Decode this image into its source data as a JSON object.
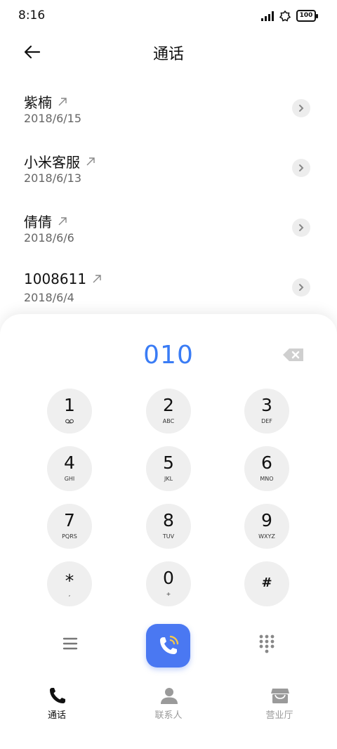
{
  "status_bar": {
    "time": "8:16",
    "battery": "100"
  },
  "header": {
    "title": "通话"
  },
  "calls": [
    {
      "name": "紫楠",
      "date": "2018/6/15"
    },
    {
      "name": "小米客服",
      "date": "2018/6/13"
    },
    {
      "name": "倩倩",
      "date": "2018/6/6"
    },
    {
      "name": "1008611",
      "date": "2018/6/4"
    }
  ],
  "dialer": {
    "number": "010",
    "keys": [
      {
        "digit": "1",
        "letters": ""
      },
      {
        "digit": "2",
        "letters": "ABC"
      },
      {
        "digit": "3",
        "letters": "DEF"
      },
      {
        "digit": "4",
        "letters": "GHI"
      },
      {
        "digit": "5",
        "letters": "JKL"
      },
      {
        "digit": "6",
        "letters": "MNO"
      },
      {
        "digit": "7",
        "letters": "PQRS"
      },
      {
        "digit": "8",
        "letters": "TUV"
      },
      {
        "digit": "9",
        "letters": "WXYZ"
      },
      {
        "digit": "*",
        "letters": ","
      },
      {
        "digit": "0",
        "letters": "+"
      },
      {
        "digit": "#",
        "letters": ""
      }
    ]
  },
  "nav": {
    "calls_label": "通话",
    "contacts_label": "联系人",
    "store_label": "营业厅"
  },
  "colors": {
    "accent": "#3a7cf5",
    "call_button": "#4a78f2",
    "key_bg": "#efefef",
    "inactive": "#9a9a9a"
  },
  "icons": [
    "signal-icon",
    "settings-icon",
    "battery-icon",
    "back-arrow-icon",
    "outgoing-call-icon",
    "chevron-right-icon",
    "backspace-icon",
    "voicemail-icon",
    "menu-icon",
    "phone-call-icon",
    "keypad-icon",
    "phone-icon",
    "person-icon",
    "store-icon"
  ]
}
